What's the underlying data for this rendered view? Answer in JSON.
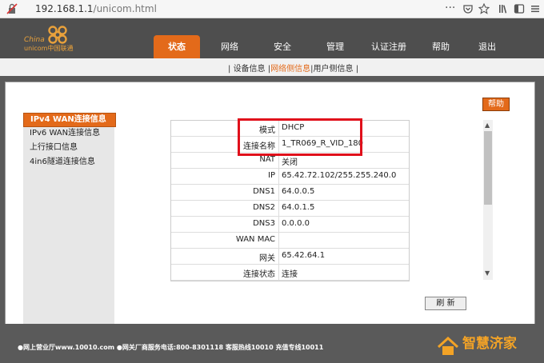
{
  "browser": {
    "url_host": "192.168.1.1",
    "url_path": "/unicom.html",
    "more_glyph": "···"
  },
  "brand": {
    "china": "China",
    "unicom": "unicom中国联通"
  },
  "nav": {
    "items": [
      "状态",
      "网络",
      "安全",
      "管理",
      "认证注册",
      "帮助",
      "退出"
    ]
  },
  "subnav": {
    "sep_left": "|",
    "device": "设备信息",
    "sep1": "|",
    "network": "网络侧信息",
    "sep2": "|",
    "user": "用户侧信息",
    "sep_right": "|"
  },
  "sidebar": {
    "items": [
      "IPv4 WAN连接信息",
      "IPv6 WAN连接信息",
      "上行接口信息",
      "4in6隧道连接信息"
    ]
  },
  "help_label": "帮助",
  "wan": {
    "rows": [
      {
        "key": "模式",
        "value": "DHCP"
      },
      {
        "key": "连接名称",
        "value": "1_TR069_R_VID_180"
      },
      {
        "key": "NAT",
        "value": "关闭"
      },
      {
        "key": "IP",
        "value": "65.42.72.102/255.255.240.0"
      },
      {
        "key": "DNS1",
        "value": "64.0.0.5"
      },
      {
        "key": "DNS2",
        "value": "64.0.1.5"
      },
      {
        "key": "DNS3",
        "value": "0.0.0.0"
      },
      {
        "key": "WAN MAC",
        "value": ""
      },
      {
        "key": "网关",
        "value": "65.42.64.1"
      },
      {
        "key": "连接状态",
        "value": "连接"
      }
    ]
  },
  "refresh_label": "刷 新",
  "footer": {
    "text": "●网上营业厅www.10010.com ●网关厂商服务电话:800-8301118 客服热线10010 充值专线10011"
  },
  "watermark": "智慧济家",
  "colors": {
    "accent": "#e36a1a",
    "highlight_box": "#e0101b"
  }
}
